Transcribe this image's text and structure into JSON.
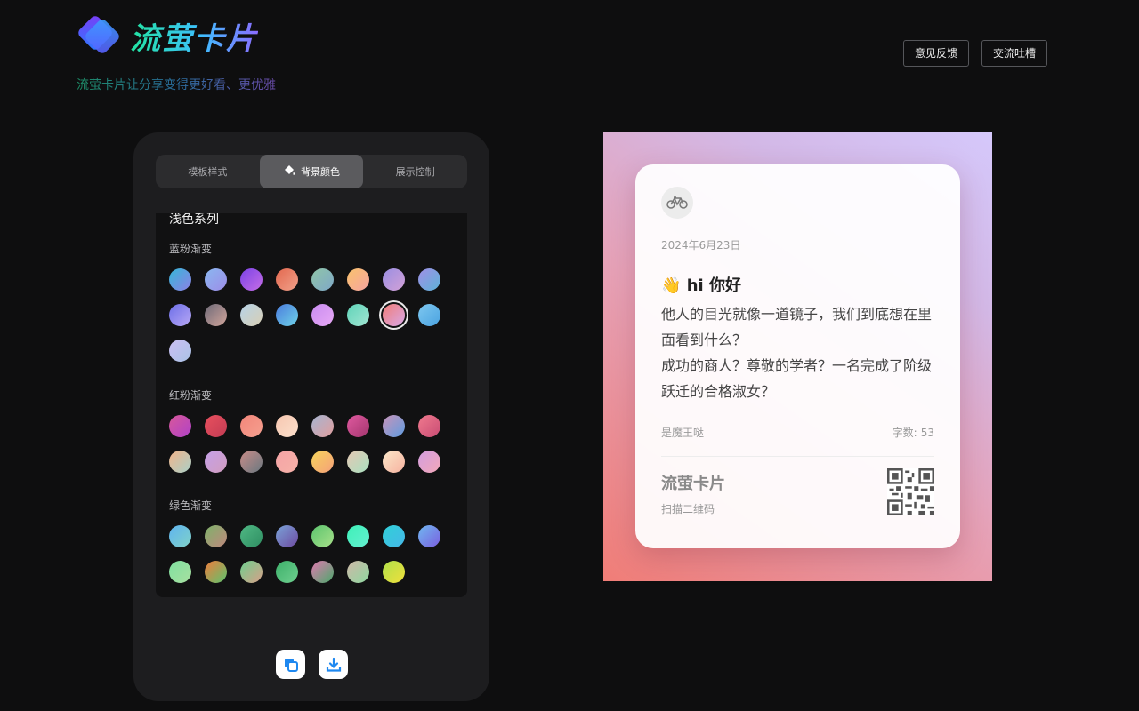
{
  "header": {
    "title": "流萤卡片",
    "slogan": "流萤卡片让分享变得更好看、更优雅",
    "feedback_label": "意见反馈",
    "chat_label": "交流吐槽"
  },
  "panel": {
    "tabs": [
      {
        "label": "模板样式"
      },
      {
        "label": "背景颜色",
        "active": true,
        "icon": "paint-bucket-icon"
      },
      {
        "label": "展示控制"
      }
    ],
    "section_title": "浅色系列",
    "groups": [
      {
        "label": "蓝粉渐变",
        "swatches": [
          [
            "#35b7d8",
            "#8e80e6"
          ],
          [
            "#8ab7f0",
            "#9d8de8"
          ],
          [
            "#7b43e6",
            "#c56de6"
          ],
          [
            "#e3684f",
            "#f0a18a"
          ],
          [
            "#8fc5a8",
            "#7fa8c8"
          ],
          [
            "#f9c26c",
            "#f6a4a1"
          ],
          [
            "#9a8ee2",
            "#d3a1d7"
          ],
          [
            "#a08fe6",
            "#5db3d8"
          ],
          [
            "#6d6fe8",
            "#b8a8f5"
          ],
          [
            "#6e6a78",
            "#d1a59b"
          ],
          [
            "#b7d3e8",
            "#d8cfb4"
          ],
          [
            "#4b7cdd",
            "#6fd3e8"
          ],
          [
            "#c88cf0",
            "#e8a9f5"
          ],
          [
            "#5fd3b8",
            "#a3e6d3"
          ],
          [
            "#f07d77",
            "#d9a8e8"
          ],
          [
            "#7ec7f0",
            "#4aa3e0"
          ],
          [
            "#cbbff3",
            "#aac3e6"
          ]
        ],
        "selected": 14
      },
      {
        "label": "红粉渐变",
        "swatches": [
          [
            "#d8589a",
            "#b042c8"
          ],
          [
            "#e8505e",
            "#c33c54"
          ],
          [
            "#f2867a",
            "#f59f8f"
          ],
          [
            "#f6c6b0",
            "#fbe0cc"
          ],
          [
            "#a6b5d1",
            "#e19e9e"
          ],
          [
            "#e05aa0",
            "#a3356e"
          ],
          [
            "#c994b9",
            "#5f9ce0"
          ],
          [
            "#f07a8e",
            "#c84c74"
          ],
          [
            "#f2b48a",
            "#a9d0c8"
          ],
          [
            "#c5a0e8",
            "#d29ec0"
          ],
          [
            "#c98c88",
            "#6a7880"
          ],
          [
            "#f4a3a6",
            "#f6b2a8"
          ],
          [
            "#f7d45b",
            "#f5a07a"
          ],
          [
            "#e6c8b4",
            "#a8e0c0"
          ],
          [
            "#fbe7c8",
            "#f6b2a0"
          ],
          [
            "#d29de0",
            "#f3a8b8"
          ]
        ]
      },
      {
        "label": "绿色渐变",
        "swatches": [
          [
            "#5fb4f0",
            "#80d2c8"
          ],
          [
            "#7eb26a",
            "#c0887e"
          ],
          [
            "#4fb884",
            "#2f8e62"
          ],
          [
            "#7aa3d8",
            "#6e4aa0"
          ],
          [
            "#5cc46e",
            "#a8e08a"
          ],
          [
            "#3ef0b8",
            "#64f0d0"
          ],
          [
            "#30d0d8",
            "#46b8e8"
          ],
          [
            "#70b8f0",
            "#7a5ee0"
          ],
          [
            "#7fe0a0",
            "#a8e0a0"
          ],
          [
            "#f07c3c",
            "#5cc46e"
          ],
          [
            "#6fcf8f",
            "#d8a088"
          ],
          [
            "#3db06a",
            "#6fcf8f"
          ],
          [
            "#e07ab0",
            "#4aa86a"
          ],
          [
            "#cfb7a8",
            "#8ed8a0"
          ],
          [
            "#b0e04a",
            "#f0e03c"
          ]
        ]
      }
    ]
  },
  "card": {
    "date": "2024年6月23日",
    "greeting_emoji": "👋",
    "greeting": "hi 你好",
    "body_line1": "他人的目光就像一道镜子，我们到底想在里面看到什么？",
    "body_line2": "成功的商人？尊敬的学者？一名完成了阶级跃迁的合格淑女？",
    "author": "是魔王哒",
    "word_count_label": "字数:",
    "word_count": "53",
    "brand": "流萤卡片",
    "scan_label": "扫描二维码"
  }
}
